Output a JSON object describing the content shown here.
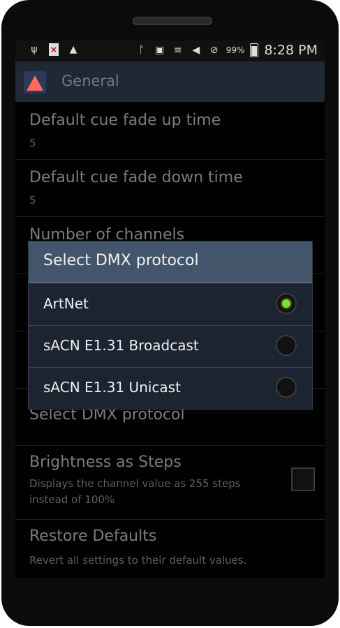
{
  "status_bar": {
    "left_icons": [
      "usb-icon",
      "sd-warning-icon",
      "warning-icon"
    ],
    "right_icons": [
      "bluetooth-icon",
      "nfc-icon",
      "vibrate-icon",
      "wifi-icon",
      "no-signal-icon"
    ],
    "battery_percent": "99%",
    "time": "8:28 PM"
  },
  "action_bar": {
    "title": "General",
    "icon": "app-icon"
  },
  "preferences": [
    {
      "title": "Default cue fade up time",
      "summary": "5"
    },
    {
      "title": "Default cue fade down time",
      "summary": "5"
    },
    {
      "title": "Number of channels",
      "summary": ""
    },
    {
      "title": "Select DMX protocol",
      "summary": ""
    },
    {
      "title": "Brightness as Steps",
      "summary": "Displays the channel value as 255 steps instead of 100%",
      "checked": false
    },
    {
      "title": "Restore Defaults",
      "summary": "Revert all settings to their default values."
    }
  ],
  "dialog": {
    "title": "Select DMX protocol",
    "options": [
      {
        "label": "ArtNet",
        "selected": true
      },
      {
        "label": "sACN E1.31 Broadcast",
        "selected": false
      },
      {
        "label": "sACN E1.31 Unicast",
        "selected": false
      }
    ]
  },
  "colors": {
    "accent_selected": "#7fe02a",
    "dialog_title_bg": "#43556a",
    "action_bar_bg": "#1f2833"
  }
}
